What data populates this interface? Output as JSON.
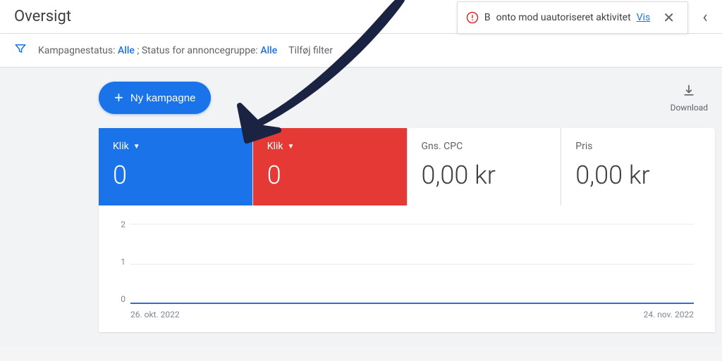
{
  "header": {
    "title": "Oversigt",
    "alert_prefix": "B",
    "alert_text": "onto mod uautoriseret aktivitet",
    "alert_link": "Vis"
  },
  "filter": {
    "campaign_label": "Kampagnestatus:",
    "campaign_value": "Alle",
    "adgroup_label": "; Status for annoncegruppe:",
    "adgroup_value": "Alle",
    "add_filter": "Tilføj filter"
  },
  "actions": {
    "new_campaign": "Ny kampagne",
    "download": "Download"
  },
  "metrics": [
    {
      "label": "Klik",
      "value": "0",
      "has_dropdown": true
    },
    {
      "label": "Klik",
      "value": "0",
      "has_dropdown": true
    },
    {
      "label": "Gns. CPC",
      "value": "0,00 kr",
      "has_dropdown": false
    },
    {
      "label": "Pris",
      "value": "0,00 kr",
      "has_dropdown": false
    }
  ],
  "chart_data": {
    "type": "line",
    "y_ticks": [
      "2",
      "1",
      "0"
    ],
    "ylim": [
      0,
      2
    ],
    "x_start": "26. okt. 2022",
    "x_end": "24. nov. 2022",
    "series": [
      {
        "name": "Klik",
        "color": "#1a73e8",
        "values": [
          0
        ]
      },
      {
        "name": "Klik",
        "color": "#e53935",
        "values": [
          0
        ]
      }
    ]
  }
}
